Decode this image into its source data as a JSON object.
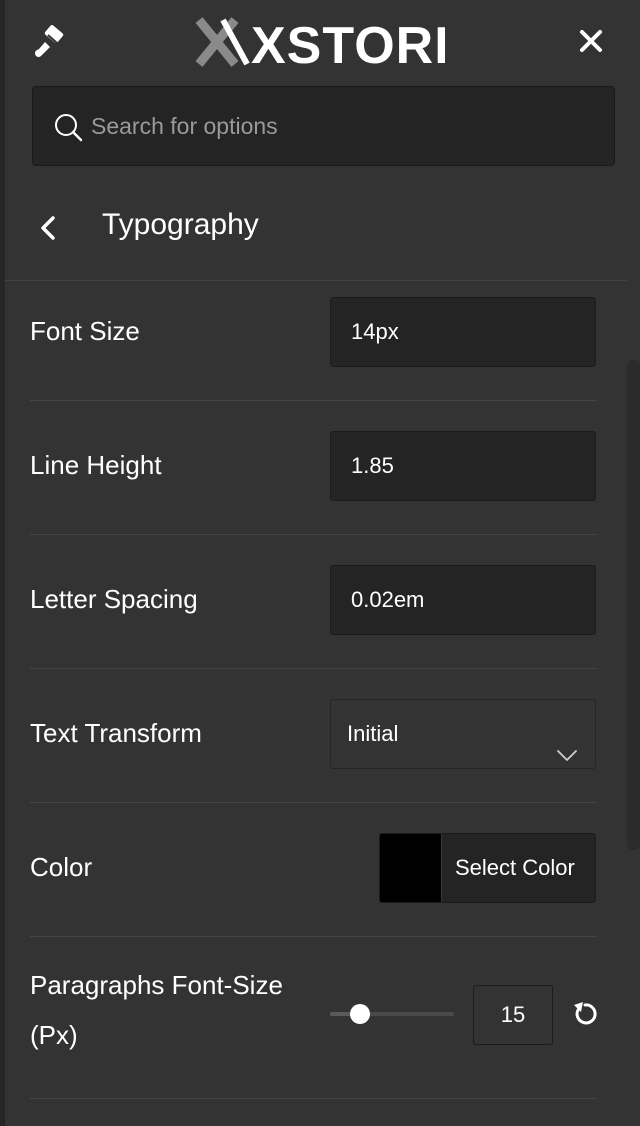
{
  "header": {
    "logo_text": "XSTORE",
    "colors": {
      "logo_x": "#8a8a8a",
      "logo_text": "#ffffff"
    }
  },
  "search": {
    "placeholder": "Search for options",
    "value": ""
  },
  "section": {
    "title": "Typography"
  },
  "fields": {
    "font_size": {
      "label": "Font Size",
      "value": "14px"
    },
    "line_height": {
      "label": "Line Height",
      "value": "1.85"
    },
    "letter_spacing": {
      "label": "Letter Spacing",
      "value": "0.02em"
    },
    "text_transform": {
      "label": "Text Transform",
      "value": "Initial"
    },
    "color": {
      "label": "Color",
      "button_label": "Select Color",
      "swatch": "#000000"
    },
    "paragraphs_font_size": {
      "label_line1": "Paragraphs Font-Size",
      "label_line2": "(Px)",
      "value": "15",
      "slider_fraction": 0.24
    }
  },
  "icons": {
    "brush": "paint-brush-icon",
    "close": "close-icon",
    "search": "search-icon",
    "back": "chevron-left-icon",
    "select": "chevron-down-icon",
    "reset": "reset-icon"
  }
}
